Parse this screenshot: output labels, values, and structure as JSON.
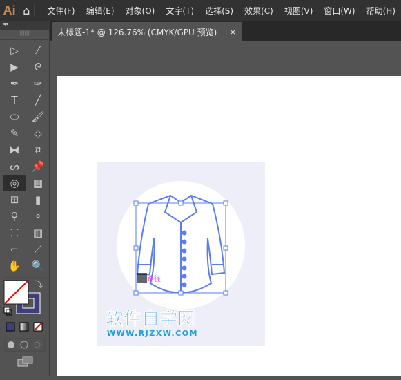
{
  "app": {
    "logo": "Ai",
    "home_icon": "home-icon"
  },
  "menu": [
    "文件(F)",
    "编辑(E)",
    "对象(O)",
    "文字(T)",
    "选择(S)",
    "效果(C)",
    "视图(V)",
    "窗口(W)",
    "帮助(H)"
  ],
  "document_tab": {
    "title": "未标题-1* @ 126.76% (CMYK/GPU 预览)",
    "close": "×"
  },
  "toolbar": {
    "collapse": "◂◂",
    "tools": [
      "selection",
      "magic-wand",
      "direct-selection",
      "lasso",
      "pen",
      "curvature",
      "type",
      "line",
      "ellipse",
      "paintbrush",
      "pencil",
      "eraser",
      "reflect",
      "scale",
      "warp",
      "puppet-warp",
      "shape-builder",
      "perspective-grid",
      "mesh",
      "gradient",
      "eyedropper",
      "blend",
      "symbol-sprayer",
      "column-graph",
      "artboard",
      "knife",
      "hand",
      "zoom"
    ],
    "active_tool": "shape-builder"
  },
  "artwork": {
    "hover_label": "路径",
    "watermark_title": "软件自学网",
    "watermark_url": "WWW.RJZXW.COM"
  },
  "colors": {
    "fill": "none",
    "stroke": "#3d3f7a",
    "accent": "#5a7df0",
    "background": "#eeeef8"
  }
}
